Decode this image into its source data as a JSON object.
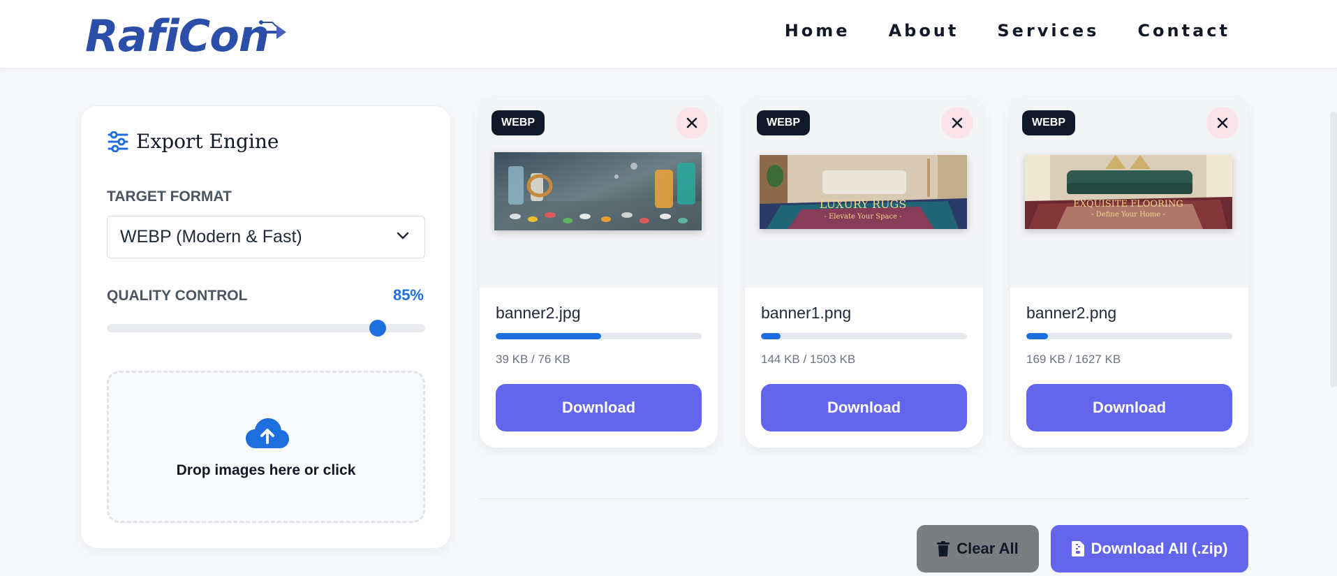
{
  "header": {
    "logo_text": "RafiCon",
    "nav": [
      "Home",
      "About",
      "Services",
      "Contact"
    ]
  },
  "panel": {
    "title": "Export Engine",
    "title_icon": "sliders-icon",
    "format_label": "TARGET FORMAT",
    "format_value": "WEBP (Modern & Fast)",
    "quality_label": "QUALITY CONTROL",
    "quality_value": "85%",
    "quality_fraction": 0.85,
    "dropzone_text": "Drop images here or click",
    "dropzone_icon": "cloud-upload-icon"
  },
  "cards": [
    {
      "badge": "WEBP",
      "filename": "banner2.jpg",
      "size": "39 KB / 76 KB",
      "progress": 0.513,
      "download_label": "Download",
      "thumb_caption": "",
      "thumb_sub": ""
    },
    {
      "badge": "WEBP",
      "filename": "banner1.png",
      "size": "144 KB / 1503 KB",
      "progress": 0.096,
      "download_label": "Download",
      "thumb_caption": "LUXURY RUGS",
      "thumb_sub": "- Elevate Your Space -"
    },
    {
      "badge": "WEBP",
      "filename": "banner2.png",
      "size": "169 KB / 1627 KB",
      "progress": 0.104,
      "download_label": "Download",
      "thumb_caption": "EXQUISITE FLOORING",
      "thumb_sub": "- Define Your Home -"
    }
  ],
  "actions": {
    "clear_label": "Clear All",
    "clear_icon": "trash-icon",
    "zip_label": "Download All (.zip)",
    "zip_icon": "file-zip-icon"
  },
  "colors": {
    "accent": "#1d6fe0",
    "button": "#6366ec",
    "clear_button": "#7b7d80",
    "badge": "#111827"
  }
}
